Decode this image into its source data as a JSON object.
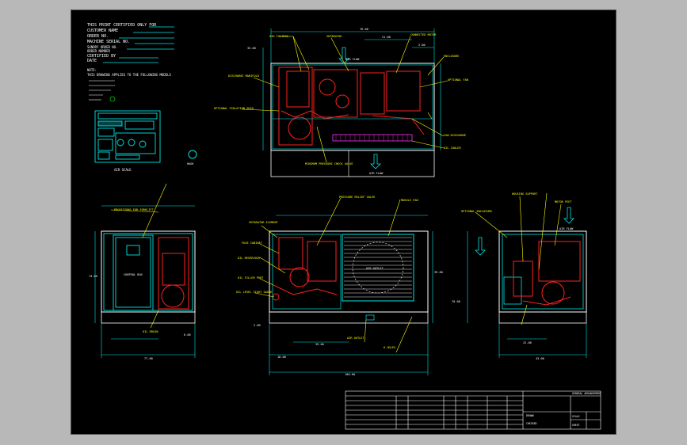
{
  "drawing": {
    "title_block_lines": [
      "THIS PRINT CERTIFIED ONLY FOR",
      "CUSTOMER NAME",
      "ORDER NO.",
      "MACHINE SERIAL NO.",
      "SUNDRY ORDER NO.",
      "ORDER NUMBER",
      "CERTIFIED BY",
      "DATE"
    ],
    "note_lines": [
      "NOTE:",
      "THIS DRAWING APPLIES TO THE FOLLOWING MODELS"
    ],
    "panel_caption": "AIR SCALE",
    "small_circle_label": "HOOK",
    "top_view_labels": {
      "air_filters": "AIR FILTERS",
      "separator": "SEPARATOR",
      "connected_motor": "CONNECTED MOTOR",
      "discharge_manifold": "DISCHARGE MANIFOLD",
      "optional_isolation": "OPTIONAL ISOLATION SKID",
      "fan_discharge": "FAN DISCHARGE",
      "air_flow_top": "AIR FLOW",
      "air_flow_mid": "AIR FLOW",
      "min_pressure_valve": "MINIMUM PRESSURE CHECK VALVE",
      "oil_cooler": "OIL COOLER",
      "optional_fan": "OPTIONAL FAN",
      "enclosure": "ENCLOSURE",
      "dim_top_a": "76.00",
      "dim_top_b": "21.00",
      "dim_top_c": "2.00",
      "dim_side": "33.00"
    },
    "front_view_labels": {
      "forklift": "PROVISIONS FOR FORKLIFT",
      "control_box": "CONTROL BOX",
      "oil_drain": "OIL DRAIN",
      "dim_height": "74.00",
      "dim_width": "77.00",
      "dim_small": "6.00"
    },
    "middle_view_labels": {
      "pressure_relief": "PRESSURE RELIEF VALVE",
      "module_fan": "MODULE FAN",
      "separator_element": "SEPARATOR ELEMENT",
      "fuse_cabinet": "FUSE CABINET",
      "oil_reservoir": "OIL RESERVOIR",
      "oil_filler": "OIL FILLER PORT",
      "oil_level": "OIL LEVEL SIGHT GAUGE",
      "air_outlet": "AIR OUTLET",
      "fan_grille_text": "AIR OUTLET",
      "dim_a": "18.00",
      "dim_b": "39.00",
      "dim_c": "108.00",
      "dim_d": "2.00",
      "dim_e": "39.00",
      "holes": "6 HOLES"
    },
    "right_view_labels": {
      "optional_enclosure": "OPTIONAL ENCLOSURE",
      "housing_support": "HOUSING SUPPORT",
      "motor_feet": "MOTOR FEET",
      "air_flow": "AIR FLOW",
      "dim_height": "70.00",
      "dim_width": "43.00",
      "dim_small": "22.00"
    },
    "title_block": {
      "heading": "GENERAL ARRANGEMENT",
      "drawn": "DRAWN",
      "checked": "CHECKED",
      "scale": "SCALE",
      "sheet": "SHEET"
    },
    "colors": {
      "background": "#000000",
      "frame": "#b8b8b8",
      "white": "#ffffff",
      "cyan": "#00e5e5",
      "yellow": "#ffff00",
      "red": "#ff2020",
      "green": "#00d000",
      "magenta": "#ff30ff"
    }
  }
}
